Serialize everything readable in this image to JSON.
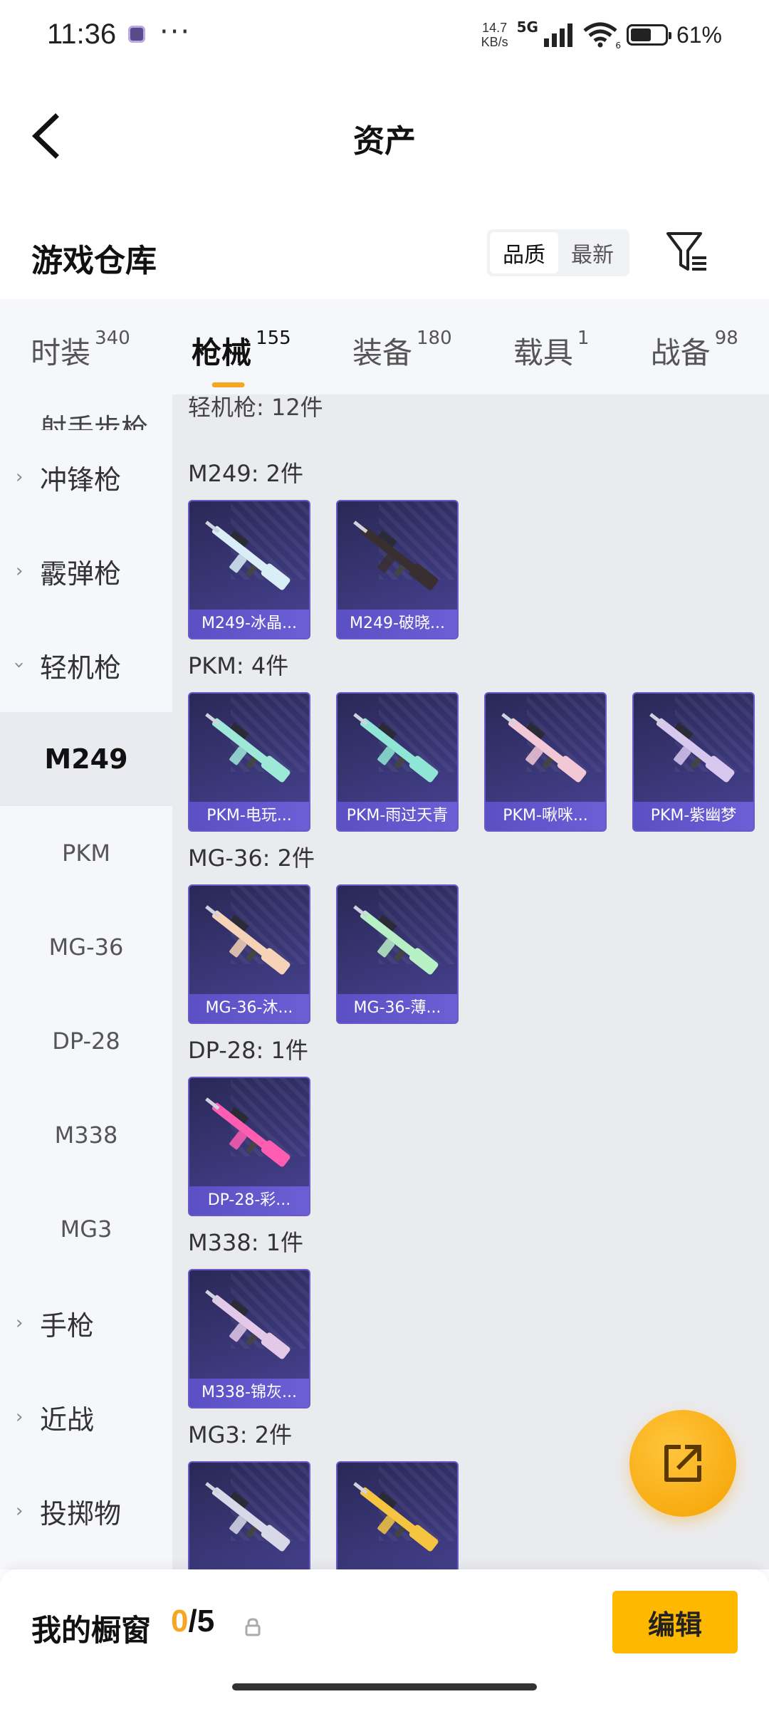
{
  "status": {
    "time": "11:36",
    "dots": "···",
    "speed_value": "14.7",
    "speed_unit": "KB/s",
    "network": "5G",
    "wifi_badge": "6",
    "battery_pct": "61%",
    "battery_level": 0.61
  },
  "header": {
    "title": "资产"
  },
  "warehouse": {
    "title": "游戏仓库",
    "sort_quality": "品质",
    "sort_newest": "最新"
  },
  "tabs": [
    {
      "label": "时装",
      "count": "340"
    },
    {
      "label": "枪械",
      "count": "155"
    },
    {
      "label": "装备",
      "count": "180"
    },
    {
      "label": "载具",
      "count": "1"
    },
    {
      "label": "战备",
      "count": "98"
    }
  ],
  "sidebar": {
    "cut_item": "射手步枪",
    "categories": [
      "冲锋枪",
      "霰弹枪",
      "轻机枪"
    ],
    "subs": [
      "M249",
      "PKM",
      "MG-36",
      "DP-28",
      "M338",
      "MG3"
    ],
    "more": [
      "手枪",
      "近战",
      "投掷物"
    ]
  },
  "content": {
    "summary": "轻机枪: 12件",
    "groups": [
      {
        "title": "M249: 2件",
        "items": [
          "M249-冰晶...",
          "M249-破晓..."
        ]
      },
      {
        "title": "PKM: 4件",
        "items": [
          "PKM-电玩...",
          "PKM-雨过天青",
          "PKM-啾咪...",
          "PKM-紫幽梦"
        ]
      },
      {
        "title": "MG-36: 2件",
        "items": [
          "MG-36-沐...",
          "MG-36-薄..."
        ]
      },
      {
        "title": "DP-28: 1件",
        "items": [
          "DP-28-彩..."
        ]
      },
      {
        "title": "M338: 1件",
        "items": [
          "M338-锦灰..."
        ]
      },
      {
        "title": "MG3: 2件",
        "items": [
          "",
          ""
        ]
      }
    ]
  },
  "bottom": {
    "title": "我的橱窗",
    "current": "0",
    "total": "/5",
    "edit": "编辑"
  },
  "colors": {
    "accent": "#f5a623",
    "edit_button": "#ffb800",
    "card_bg": "#3a3778",
    "card_label": "#6c5fd6"
  }
}
